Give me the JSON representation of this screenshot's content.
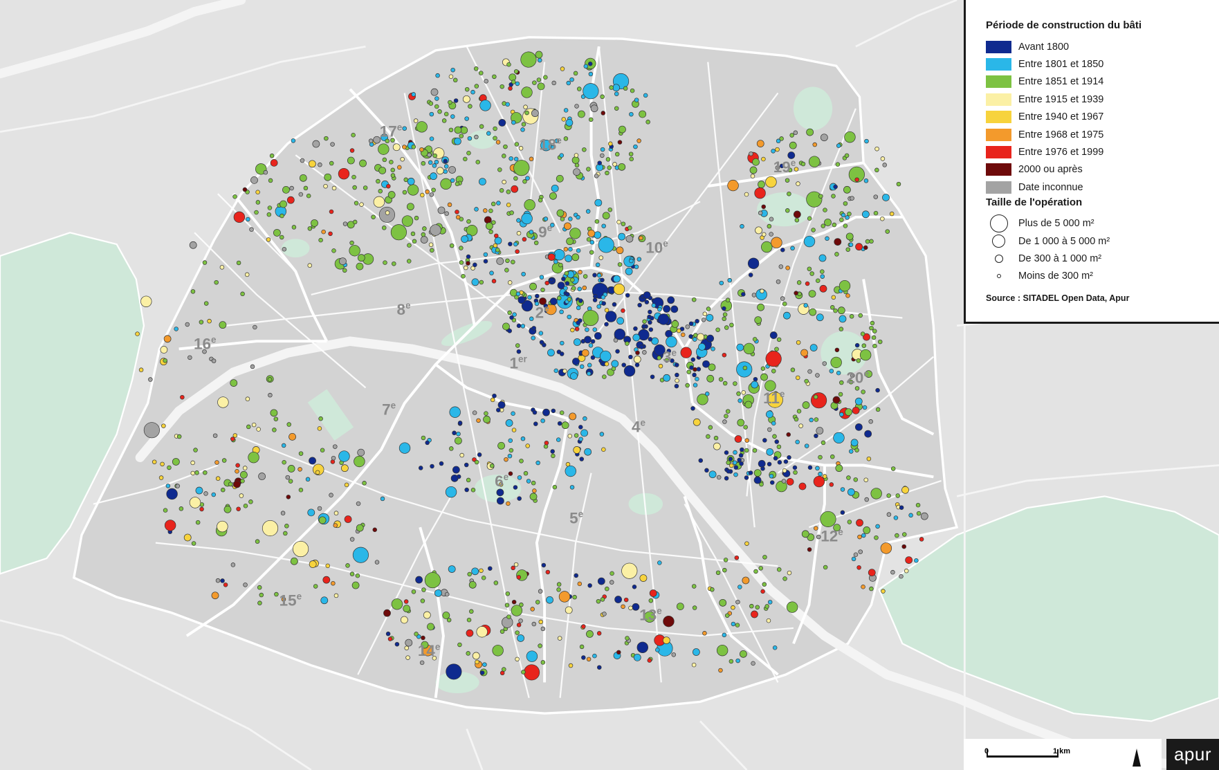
{
  "legend": {
    "period_title": "Période de construction du bâti",
    "periods": [
      {
        "label": "Avant 1800",
        "color": "#0f2a8f"
      },
      {
        "label": "Entre 1801 et 1850",
        "color": "#2ab7e8"
      },
      {
        "label": "Entre 1851 et 1914",
        "color": "#7dc242"
      },
      {
        "label": "Entre 1915 et 1939",
        "color": "#fbf0a5"
      },
      {
        "label": "Entre 1940 et 1967",
        "color": "#f7d33d"
      },
      {
        "label": "Entre 1968 et 1975",
        "color": "#f39a2c"
      },
      {
        "label": "Entre 1976 et 1999",
        "color": "#e8241c"
      },
      {
        "label": "2000 ou après",
        "color": "#6e0a0a"
      },
      {
        "label": "Date inconnue",
        "color": "#a3a3a3"
      }
    ],
    "size_title": "Taille de l'opération",
    "sizes": [
      {
        "label": "Plus de 5 000 m²"
      },
      {
        "label": "De 1 000 à 5 000 m²"
      },
      {
        "label": "De 300 à 1 000 m²"
      },
      {
        "label": "Moins de 300 m²"
      }
    ],
    "source": "Source : SITADEL Open Data, Apur"
  },
  "scale": {
    "zero": "0",
    "km": "1 km"
  },
  "brand": "apur",
  "arrondissements": [
    {
      "num": "1",
      "sup": "er"
    },
    {
      "num": "2",
      "sup": "e"
    },
    {
      "num": "3",
      "sup": "e"
    },
    {
      "num": "4",
      "sup": "e"
    },
    {
      "num": "5",
      "sup": "e"
    },
    {
      "num": "6",
      "sup": "e"
    },
    {
      "num": "7",
      "sup": "e"
    },
    {
      "num": "8",
      "sup": "e"
    },
    {
      "num": "9",
      "sup": "e"
    },
    {
      "num": "10",
      "sup": "e"
    },
    {
      "num": "11",
      "sup": "e"
    },
    {
      "num": "12",
      "sup": "e"
    },
    {
      "num": "13",
      "sup": "e"
    },
    {
      "num": "14",
      "sup": "e"
    },
    {
      "num": "15",
      "sup": "e"
    },
    {
      "num": "16",
      "sup": "e"
    },
    {
      "num": "17",
      "sup": "e"
    },
    {
      "num": "18",
      "sup": "e"
    },
    {
      "num": "19",
      "sup": "e"
    },
    {
      "num": "20",
      "sup": "e"
    }
  ],
  "colors": {
    "map_bg": "#e3e3e3",
    "city_fill": "#d2d2d2",
    "park": "#cfe8d9",
    "seine": "#f4f4f4",
    "roads": "#ffffff",
    "boundary": "#ffffff"
  }
}
